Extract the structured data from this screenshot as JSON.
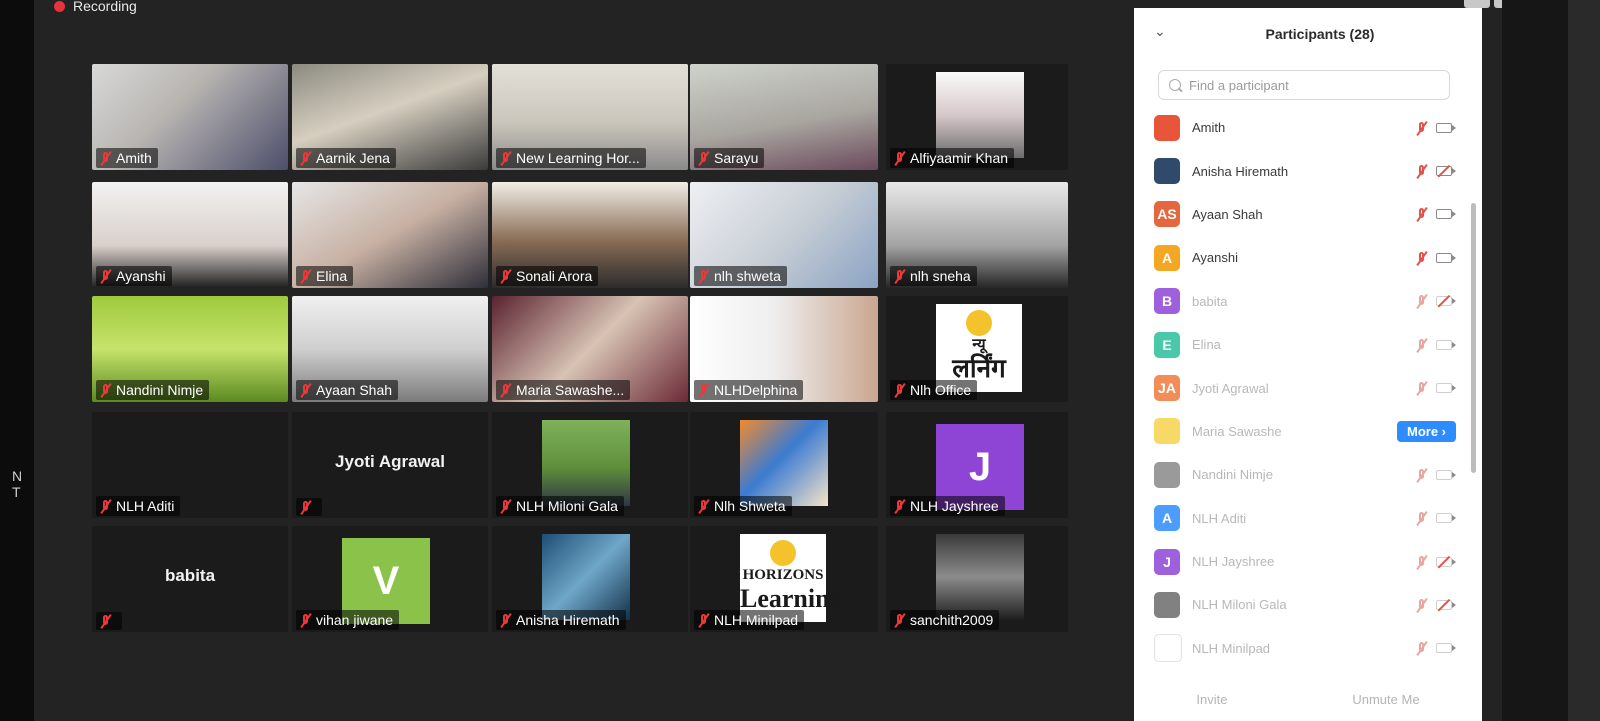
{
  "app": {
    "recording_label": "Recording",
    "monitor_side_text": "NT"
  },
  "gallery": [
    {
      "name": "Amith",
      "kind": "video",
      "style": "photo-1"
    },
    {
      "name": "Aarnik Jena",
      "kind": "video",
      "style": "photo-2"
    },
    {
      "name": "New Learning Hor...",
      "kind": "video",
      "style": "photo-3",
      "active": true
    },
    {
      "name": "Sarayu",
      "kind": "video",
      "style": "photo-4"
    },
    {
      "name": "Alfiyaamir Khan",
      "kind": "thumb",
      "style": "photo-e"
    },
    {
      "name": "Ayanshi",
      "kind": "video",
      "style": "photo-5"
    },
    {
      "name": "Elina",
      "kind": "video",
      "style": "photo-6"
    },
    {
      "name": "Sonali Arora",
      "kind": "video",
      "style": "photo-8"
    },
    {
      "name": "nlh shweta",
      "kind": "video",
      "style": "photo-9"
    },
    {
      "name": "nlh sneha",
      "kind": "video",
      "style": "photo-10"
    },
    {
      "name": "Nandini Nimje",
      "kind": "video",
      "style": "photo-11"
    },
    {
      "name": "Ayaan  Shah",
      "kind": "video",
      "style": "photo-12"
    },
    {
      "name": "Maria Sawashe...",
      "kind": "video",
      "style": "photo-13"
    },
    {
      "name": "NLHDelphina",
      "kind": "video",
      "style": "photo-14"
    },
    {
      "name": "Nlh Office",
      "kind": "logo",
      "logo_big": "लर्निंग",
      "logo_small": "न्यू"
    },
    {
      "name": "NLH Aditi",
      "kind": "blank"
    },
    {
      "name": "",
      "kind": "name-center",
      "center": "Jyoti Agrawal"
    },
    {
      "name": "NLH Miloni Gala",
      "kind": "thumb",
      "style": "photo-a"
    },
    {
      "name": "Nlh Shweta",
      "kind": "thumb",
      "style": "photo-b"
    },
    {
      "name": "NLH Jayshree",
      "kind": "avatar",
      "letter": "J",
      "color": "#8e45d6"
    },
    {
      "name": "",
      "kind": "name-center",
      "center": "babita"
    },
    {
      "name": "vihan jiwane",
      "kind": "avatar",
      "letter": "V",
      "color": "#8bc34a"
    },
    {
      "name": "Anisha Hiremath",
      "kind": "thumb",
      "style": "photo-c"
    },
    {
      "name": "NLH Minilpad",
      "kind": "logo",
      "logo_big": "Learning",
      "logo_small": "HORIZONS"
    },
    {
      "name": "sanchith2009",
      "kind": "thumb",
      "style": "photo-d"
    }
  ],
  "participants": {
    "title": "Participants (28)",
    "search_placeholder": "Find a participant",
    "more_label": "More ›",
    "invite_label": "Invite",
    "unmute_label": "Unmute Me",
    "list": [
      {
        "name": "Amith",
        "avatar": "",
        "color": "#e9553b",
        "cam_off": false
      },
      {
        "name": "Anisha Hiremath",
        "avatar": "",
        "color": "#2f4a6b",
        "cam_off": true
      },
      {
        "name": "Ayaan  Shah",
        "avatar": "AS",
        "color": "#e5673f",
        "cam_off": false
      },
      {
        "name": "Ayanshi",
        "avatar": "A",
        "color": "#f5a623",
        "cam_off": false
      },
      {
        "name": "babita",
        "avatar": "B",
        "color": "#8e45d6",
        "cam_off": true,
        "faded": true
      },
      {
        "name": "Elina",
        "avatar": "E",
        "color": "#2bbf9b",
        "cam_off": false,
        "faded": true
      },
      {
        "name": "Jyoti Agrawal",
        "avatar": "JA",
        "color": "#f07a3e",
        "cam_off": false,
        "faded": true
      },
      {
        "name": "Maria Sawashe",
        "avatar": "",
        "color": "#f7d24a",
        "more": true,
        "faded": true
      },
      {
        "name": "Nandini Nimje",
        "avatar": "",
        "color": "#888888",
        "cam_off": false,
        "faded": true
      },
      {
        "name": "NLH Aditi",
        "avatar": "A",
        "color": "#2d8cff",
        "cam_off": false,
        "faded": true
      },
      {
        "name": "NLH Jayshree",
        "avatar": "J",
        "color": "#8e45d6",
        "cam_off": true,
        "faded": true
      },
      {
        "name": "NLH Miloni Gala",
        "avatar": "",
        "color": "#6b6b6b",
        "cam_off": true,
        "faded": true
      },
      {
        "name": "NLH Minilpad",
        "avatar": "",
        "color": "#ffffff",
        "cam_off": false,
        "faded": true
      }
    ]
  }
}
